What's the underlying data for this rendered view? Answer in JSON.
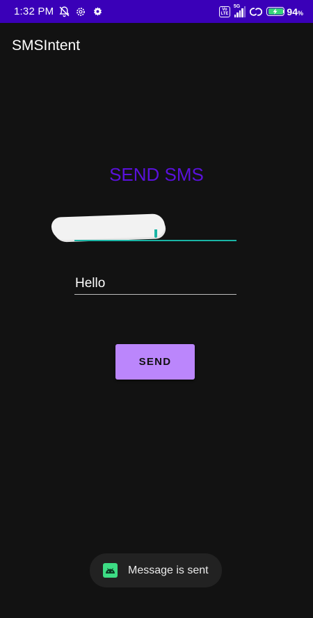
{
  "status_bar": {
    "time": "1:32 PM",
    "icons": [
      "no-notifications-icon",
      "settings-icon",
      "gear-icon"
    ],
    "volte_top": "Vo",
    "volte_bottom": "LTE",
    "network_type": "5G",
    "sync_icon": "sync-icon",
    "battery_percent": "94",
    "battery_unit": "%",
    "battery_level": 0.94,
    "battery_color": "#36d37a",
    "background_color": "#3a00b8"
  },
  "app_bar": {
    "title": "SMSIntent"
  },
  "main": {
    "heading": "SEND SMS",
    "heading_color": "#5a11dc",
    "phone_field": {
      "value": "",
      "redacted": true,
      "accent_color": "#1ab5a5"
    },
    "message_field": {
      "value": "Hello"
    },
    "send_button": {
      "label": "SEND",
      "color": "#bb86fc"
    }
  },
  "toast": {
    "icon": "android-icon",
    "message": "Message is sent"
  }
}
